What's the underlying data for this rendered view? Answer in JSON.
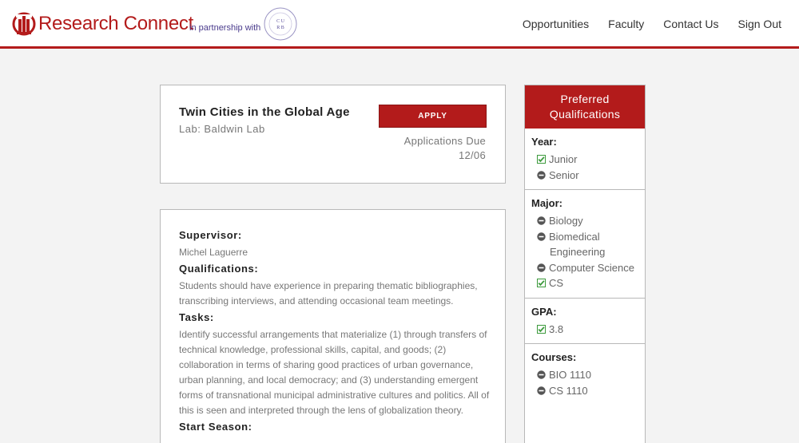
{
  "header": {
    "brand_name": "Research Connect",
    "partner_text": "in partnership with",
    "seal_letters": "C U R B",
    "nav": [
      "Opportunities",
      "Faculty",
      "Contact Us",
      "Sign Out"
    ]
  },
  "opportunity": {
    "title": "Twin Cities in the Global Age",
    "lab": "Lab: Baldwin Lab",
    "apply_label": "APPLY",
    "due_label": "Applications Due",
    "due_date": "12/06"
  },
  "details": {
    "supervisor_label": "Supervisor:",
    "supervisor": "Michel Laguerre",
    "qualifications_label": "Qualifications:",
    "qualifications": "Students should have experience in preparing thematic bibliographies, transcribing interviews, and attending occasional team meetings.",
    "tasks_label": "Tasks:",
    "tasks": "Identify successful arrangements that materialize (1) through transfers of technical knowledge, professional skills, capital, and goods; (2) collaboration in terms of sharing good practices of urban governance, urban planning, and local democracy; and (3) understanding emergent forms of transnational municipal administrative cultures and politics. All of this is seen and interpreted through the lens of globalization theory.",
    "start_label": "Start Season:"
  },
  "sidebar": {
    "title": "Preferred Qualifications",
    "sections": [
      {
        "title": "Year:",
        "items": [
          {
            "label": "Junior",
            "status": "check"
          },
          {
            "label": "Senior",
            "status": "minus"
          }
        ]
      },
      {
        "title": "Major:",
        "items": [
          {
            "label": "Biology",
            "status": "minus"
          },
          {
            "label": "Biomedical Engineering",
            "status": "minus"
          },
          {
            "label": "Computer Science",
            "status": "minus"
          },
          {
            "label": "CS",
            "status": "check"
          }
        ]
      },
      {
        "title": "GPA:",
        "items": [
          {
            "label": "3.8",
            "status": "check"
          }
        ]
      },
      {
        "title": "Courses:",
        "items": [
          {
            "label": "BIO 1110",
            "status": "minus"
          },
          {
            "label": "CS 1110",
            "status": "minus"
          }
        ]
      }
    ]
  },
  "colors": {
    "brand": "#b31b1b",
    "check": "#3c9a3c",
    "minus": "#555555"
  }
}
